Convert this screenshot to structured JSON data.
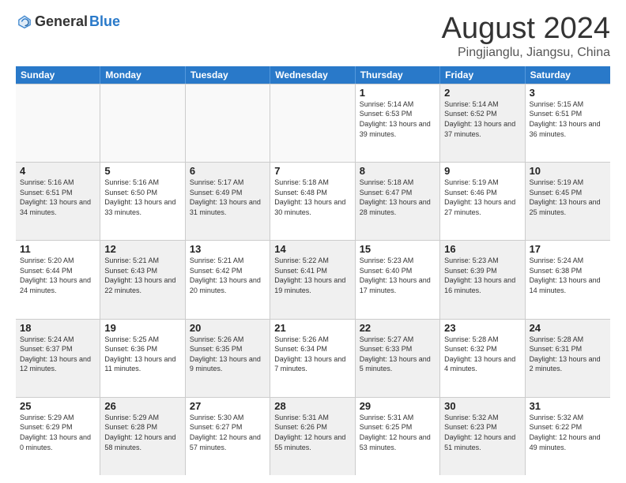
{
  "logo": {
    "text_general": "General",
    "text_blue": "Blue"
  },
  "title": "August 2024",
  "location": "Pingjianglu, Jiangsu, China",
  "header_days": [
    "Sunday",
    "Monday",
    "Tuesday",
    "Wednesday",
    "Thursday",
    "Friday",
    "Saturday"
  ],
  "weeks": [
    [
      {
        "day": "",
        "info": "",
        "empty": true
      },
      {
        "day": "",
        "info": "",
        "empty": true
      },
      {
        "day": "",
        "info": "",
        "empty": true
      },
      {
        "day": "",
        "info": "",
        "empty": true
      },
      {
        "day": "1",
        "info": "Sunrise: 5:14 AM\nSunset: 6:53 PM\nDaylight: 13 hours\nand 39 minutes.",
        "shaded": false
      },
      {
        "day": "2",
        "info": "Sunrise: 5:14 AM\nSunset: 6:52 PM\nDaylight: 13 hours\nand 37 minutes.",
        "shaded": true
      },
      {
        "day": "3",
        "info": "Sunrise: 5:15 AM\nSunset: 6:51 PM\nDaylight: 13 hours\nand 36 minutes.",
        "shaded": false
      }
    ],
    [
      {
        "day": "4",
        "info": "Sunrise: 5:16 AM\nSunset: 6:51 PM\nDaylight: 13 hours\nand 34 minutes.",
        "shaded": true
      },
      {
        "day": "5",
        "info": "Sunrise: 5:16 AM\nSunset: 6:50 PM\nDaylight: 13 hours\nand 33 minutes.",
        "shaded": false
      },
      {
        "day": "6",
        "info": "Sunrise: 5:17 AM\nSunset: 6:49 PM\nDaylight: 13 hours\nand 31 minutes.",
        "shaded": true
      },
      {
        "day": "7",
        "info": "Sunrise: 5:18 AM\nSunset: 6:48 PM\nDaylight: 13 hours\nand 30 minutes.",
        "shaded": false
      },
      {
        "day": "8",
        "info": "Sunrise: 5:18 AM\nSunset: 6:47 PM\nDaylight: 13 hours\nand 28 minutes.",
        "shaded": true
      },
      {
        "day": "9",
        "info": "Sunrise: 5:19 AM\nSunset: 6:46 PM\nDaylight: 13 hours\nand 27 minutes.",
        "shaded": false
      },
      {
        "day": "10",
        "info": "Sunrise: 5:19 AM\nSunset: 6:45 PM\nDaylight: 13 hours\nand 25 minutes.",
        "shaded": true
      }
    ],
    [
      {
        "day": "11",
        "info": "Sunrise: 5:20 AM\nSunset: 6:44 PM\nDaylight: 13 hours\nand 24 minutes.",
        "shaded": false
      },
      {
        "day": "12",
        "info": "Sunrise: 5:21 AM\nSunset: 6:43 PM\nDaylight: 13 hours\nand 22 minutes.",
        "shaded": true
      },
      {
        "day": "13",
        "info": "Sunrise: 5:21 AM\nSunset: 6:42 PM\nDaylight: 13 hours\nand 20 minutes.",
        "shaded": false
      },
      {
        "day": "14",
        "info": "Sunrise: 5:22 AM\nSunset: 6:41 PM\nDaylight: 13 hours\nand 19 minutes.",
        "shaded": true
      },
      {
        "day": "15",
        "info": "Sunrise: 5:23 AM\nSunset: 6:40 PM\nDaylight: 13 hours\nand 17 minutes.",
        "shaded": false
      },
      {
        "day": "16",
        "info": "Sunrise: 5:23 AM\nSunset: 6:39 PM\nDaylight: 13 hours\nand 16 minutes.",
        "shaded": true
      },
      {
        "day": "17",
        "info": "Sunrise: 5:24 AM\nSunset: 6:38 PM\nDaylight: 13 hours\nand 14 minutes.",
        "shaded": false
      }
    ],
    [
      {
        "day": "18",
        "info": "Sunrise: 5:24 AM\nSunset: 6:37 PM\nDaylight: 13 hours\nand 12 minutes.",
        "shaded": true
      },
      {
        "day": "19",
        "info": "Sunrise: 5:25 AM\nSunset: 6:36 PM\nDaylight: 13 hours\nand 11 minutes.",
        "shaded": false
      },
      {
        "day": "20",
        "info": "Sunrise: 5:26 AM\nSunset: 6:35 PM\nDaylight: 13 hours\nand 9 minutes.",
        "shaded": true
      },
      {
        "day": "21",
        "info": "Sunrise: 5:26 AM\nSunset: 6:34 PM\nDaylight: 13 hours\nand 7 minutes.",
        "shaded": false
      },
      {
        "day": "22",
        "info": "Sunrise: 5:27 AM\nSunset: 6:33 PM\nDaylight: 13 hours\nand 5 minutes.",
        "shaded": true
      },
      {
        "day": "23",
        "info": "Sunrise: 5:28 AM\nSunset: 6:32 PM\nDaylight: 13 hours\nand 4 minutes.",
        "shaded": false
      },
      {
        "day": "24",
        "info": "Sunrise: 5:28 AM\nSunset: 6:31 PM\nDaylight: 13 hours\nand 2 minutes.",
        "shaded": true
      }
    ],
    [
      {
        "day": "25",
        "info": "Sunrise: 5:29 AM\nSunset: 6:29 PM\nDaylight: 13 hours\nand 0 minutes.",
        "shaded": false
      },
      {
        "day": "26",
        "info": "Sunrise: 5:29 AM\nSunset: 6:28 PM\nDaylight: 12 hours\nand 58 minutes.",
        "shaded": true
      },
      {
        "day": "27",
        "info": "Sunrise: 5:30 AM\nSunset: 6:27 PM\nDaylight: 12 hours\nand 57 minutes.",
        "shaded": false
      },
      {
        "day": "28",
        "info": "Sunrise: 5:31 AM\nSunset: 6:26 PM\nDaylight: 12 hours\nand 55 minutes.",
        "shaded": true
      },
      {
        "day": "29",
        "info": "Sunrise: 5:31 AM\nSunset: 6:25 PM\nDaylight: 12 hours\nand 53 minutes.",
        "shaded": false
      },
      {
        "day": "30",
        "info": "Sunrise: 5:32 AM\nSunset: 6:23 PM\nDaylight: 12 hours\nand 51 minutes.",
        "shaded": true
      },
      {
        "day": "31",
        "info": "Sunrise: 5:32 AM\nSunset: 6:22 PM\nDaylight: 12 hours\nand 49 minutes.",
        "shaded": false
      }
    ]
  ]
}
